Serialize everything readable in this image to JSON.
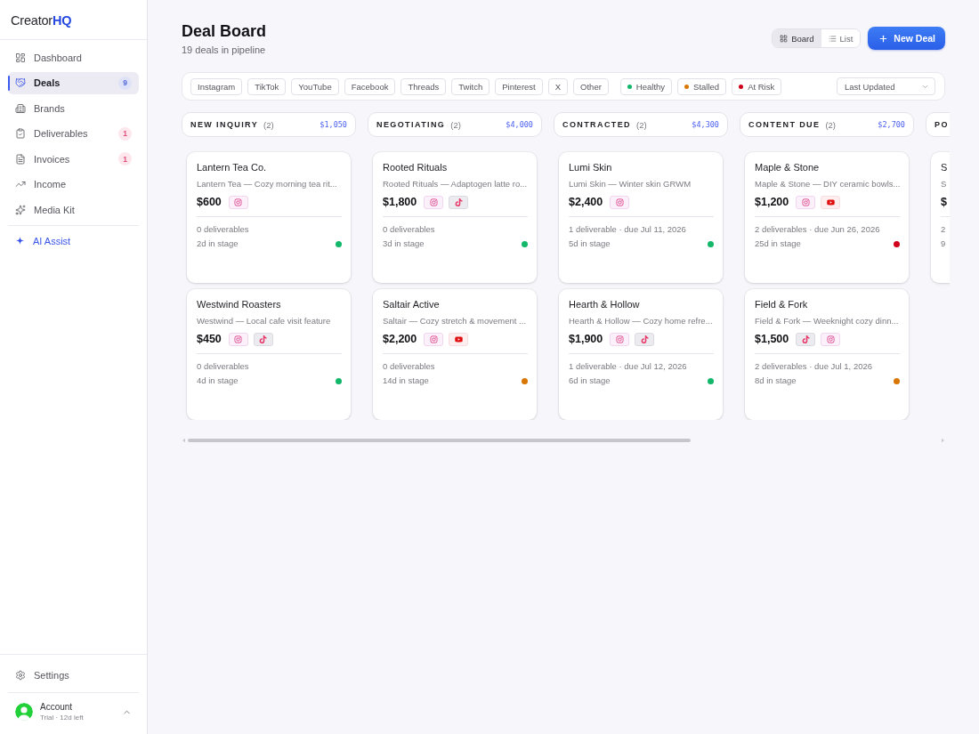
{
  "sidebar": {
    "logo": {
      "text": "Creator",
      "accent": "HQ"
    },
    "nav_items": [
      {
        "label": "Dashboard",
        "kind": "dashboard",
        "selected": false
      },
      {
        "label": "Deals",
        "kind": "deals",
        "selected": true,
        "badge": "9"
      },
      {
        "label": "Brands",
        "kind": "brands",
        "selected": false
      },
      {
        "label": "Deliverables",
        "kind": "deliverables",
        "selected": false,
        "badge": "1"
      },
      {
        "label": "Invoices",
        "kind": "invoices",
        "selected": false,
        "badge": "1"
      },
      {
        "label": "Income",
        "kind": "income",
        "selected": false
      },
      {
        "label": "Media Kit",
        "kind": "mediakit",
        "selected": false
      }
    ],
    "assist": {
      "label": "AI Assist"
    },
    "settings": {
      "label": "Settings"
    },
    "account": {
      "name": "Account",
      "plan": "Trial · 12d left"
    }
  },
  "header": {
    "title": "Deal Board",
    "subtitle": "19 deals in pipeline",
    "views": [
      {
        "label": "Board",
        "kind": "board",
        "selected": true
      },
      {
        "label": "List",
        "kind": "list",
        "selected": false
      }
    ],
    "new_button": "New Deal"
  },
  "filters": {
    "platforms": [
      {
        "label": "Instagram"
      },
      {
        "label": "TikTok"
      },
      {
        "label": "YouTube"
      },
      {
        "label": "Facebook"
      },
      {
        "label": "Threads"
      },
      {
        "label": "Twitch"
      },
      {
        "label": "Pinterest"
      },
      {
        "label": "X"
      },
      {
        "label": "Other"
      }
    ],
    "statuses": [
      {
        "label": "Healthy",
        "color": "#12b76a"
      },
      {
        "label": "Stalled",
        "color": "#d97706"
      },
      {
        "label": "At Risk",
        "color": "#d0021b"
      }
    ],
    "sort": {
      "value": "Last Updated"
    }
  },
  "columns": [
    {
      "title": "NEW INQUIRY",
      "count": "(2)",
      "total": "$1,050",
      "cards": [
        {
          "name": "Lantern Tea Co.",
          "description": "Lantern Tea — Cozy morning tea rit...",
          "amount": "$600",
          "platforms": [
            {
              "kind": "instagram"
            }
          ],
          "deliverables": "0 deliverables",
          "stage": "2d in stage",
          "color": "#12b76a"
        },
        {
          "name": "Westwind Roasters",
          "description": "Westwind — Local cafe visit feature",
          "amount": "$450",
          "platforms": [
            {
              "kind": "instagram"
            },
            {
              "kind": "tiktok"
            }
          ],
          "deliverables": "0 deliverables",
          "stage": "4d in stage",
          "color": "#12b76a"
        }
      ]
    },
    {
      "title": "NEGOTIATING",
      "count": "(2)",
      "total": "$4,000",
      "cards": [
        {
          "name": "Rooted Rituals",
          "description": "Rooted Rituals — Adaptogen latte ro...",
          "amount": "$1,800",
          "platforms": [
            {
              "kind": "instagram"
            },
            {
              "kind": "tiktok"
            }
          ],
          "deliverables": "0 deliverables",
          "stage": "3d in stage",
          "color": "#12b76a"
        },
        {
          "name": "Saltair Active",
          "description": "Saltair — Cozy stretch & movement ...",
          "amount": "$2,200",
          "platforms": [
            {
              "kind": "instagram"
            },
            {
              "kind": "youtube"
            }
          ],
          "deliverables": "0 deliverables",
          "stage": "14d in stage",
          "color": "#d97706"
        }
      ]
    },
    {
      "title": "CONTRACTED",
      "count": "(2)",
      "total": "$4,300",
      "cards": [
        {
          "name": "Lumi Skin",
          "description": "Lumi Skin — Winter skin GRWM",
          "amount": "$2,400",
          "platforms": [
            {
              "kind": "instagram"
            }
          ],
          "deliverables": "1 deliverable · due Jul 11, 2026",
          "stage": "5d in stage",
          "color": "#12b76a"
        },
        {
          "name": "Hearth & Hollow",
          "description": "Hearth & Hollow — Cozy home refre...",
          "amount": "$1,900",
          "platforms": [
            {
              "kind": "instagram"
            },
            {
              "kind": "tiktok"
            }
          ],
          "deliverables": "1 deliverable · due Jul 12, 2026",
          "stage": "6d in stage",
          "color": "#12b76a"
        }
      ]
    },
    {
      "title": "CONTENT DUE",
      "count": "(2)",
      "total": "$2,700",
      "cards": [
        {
          "name": "Maple & Stone",
          "description": "Maple & Stone — DIY ceramic bowls...",
          "amount": "$1,200",
          "platforms": [
            {
              "kind": "instagram"
            },
            {
              "kind": "youtube"
            }
          ],
          "deliverables": "2 deliverables · due Jun 26, 2026",
          "stage": "25d in stage",
          "color": "#d0021b"
        },
        {
          "name": "Field & Fork",
          "description": "Field & Fork — Weeknight cozy dinn...",
          "amount": "$1,500",
          "platforms": [
            {
              "kind": "tiktok"
            },
            {
              "kind": "instagram"
            }
          ],
          "deliverables": "2 deliverables · due Jul 1, 2026",
          "stage": "8d in stage",
          "color": "#d97706"
        }
      ]
    },
    {
      "title": "PO",
      "cards": [
        {
          "name": "S",
          "description": "S",
          "amount": "$",
          "deliverables": "2",
          "stage": "9"
        }
      ]
    }
  ]
}
